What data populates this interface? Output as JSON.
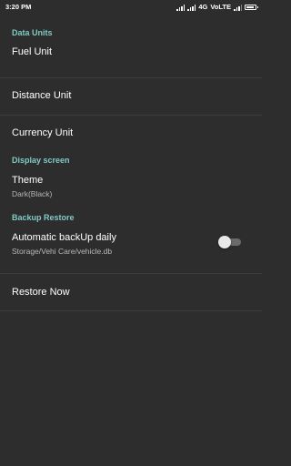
{
  "status_bar": {
    "time": "3:20 PM",
    "network": "4G",
    "volte": "VoLTE",
    "battery_level": 0.9
  },
  "sections": {
    "data_units": {
      "header": "Data Units",
      "fuel_unit": "Fuel Unit",
      "distance_unit": "Distance Unit",
      "currency_unit": "Currency Unit"
    },
    "display_screen": {
      "header": "Display screen",
      "theme_title": "Theme",
      "theme_value": "Dark(Black)"
    },
    "backup_restore": {
      "header": "Backup Restore",
      "auto_backup_title": "Automatic backUp daily",
      "auto_backup_path": "Storage/Vehi Care/vehicle.db",
      "auto_backup_enabled": false,
      "restore_now": "Restore Now"
    }
  },
  "colors": {
    "background": "#2d2d2d",
    "section_header": "#80cbc4",
    "divider": "#3d3d3d"
  }
}
